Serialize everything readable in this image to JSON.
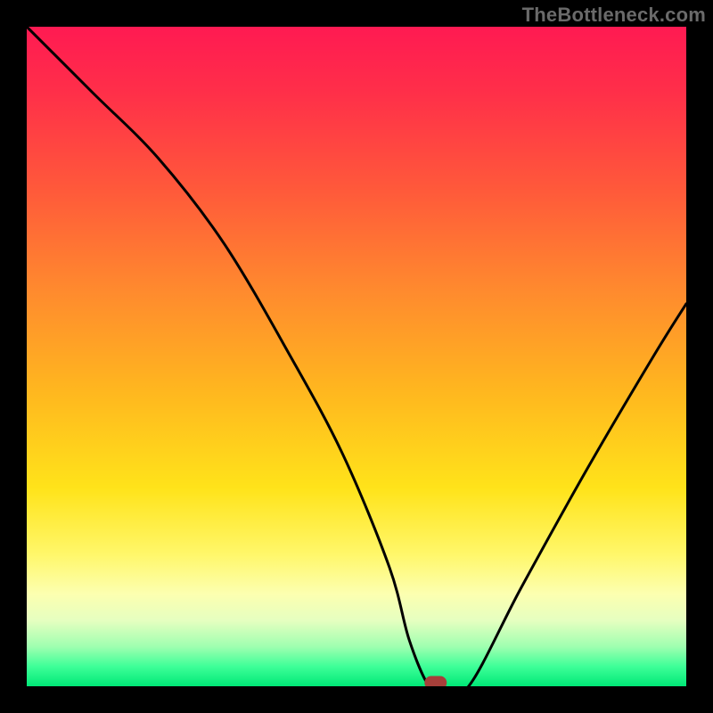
{
  "attribution": "TheBottleneck.com",
  "chart_data": {
    "type": "line",
    "title": "",
    "xlabel": "",
    "ylabel": "",
    "xlim": [
      0,
      100
    ],
    "ylim": [
      0,
      100
    ],
    "x": [
      0,
      10,
      20,
      30,
      40,
      48,
      55,
      58,
      61,
      63,
      67,
      75,
      85,
      95,
      100
    ],
    "values": [
      100,
      90,
      80,
      67,
      50,
      35,
      18,
      7,
      0,
      0,
      0,
      15,
      33,
      50,
      58
    ],
    "optimum_x": 62,
    "optimum_y": 0
  },
  "colors": {
    "background": "#000000",
    "gradient_top": "#ff1a52",
    "gradient_bottom": "#00e877",
    "curve": "#000000",
    "marker": "#a63f3a",
    "attribution_text": "#6a6a6a"
  }
}
